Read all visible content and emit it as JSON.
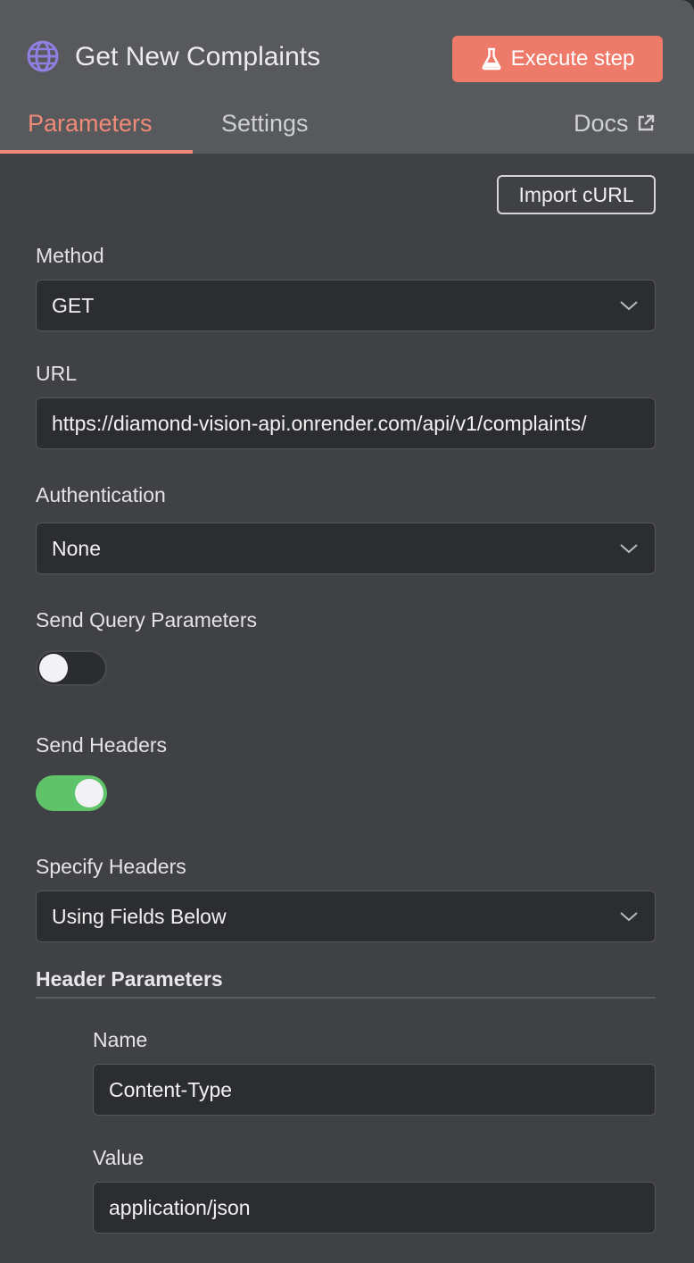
{
  "node": {
    "title": "Get New Complaints",
    "icon": "globe-icon",
    "execute_label": "Execute step"
  },
  "tabs": [
    {
      "label": "Parameters",
      "active": true
    },
    {
      "label": "Settings",
      "active": false
    },
    {
      "label": "Docs",
      "active": false
    }
  ],
  "import_curl_label": "Import cURL",
  "method": {
    "label": "Method",
    "value": "GET"
  },
  "url": {
    "label": "URL",
    "value": "https://diamond-vision-api.onrender.com/api/v1/complaints/"
  },
  "authentication": {
    "label": "Authentication",
    "value": "None"
  },
  "send_query": {
    "label": "Send Query Parameters",
    "enabled": false
  },
  "send_headers": {
    "label": "Send Headers",
    "enabled": true
  },
  "specify_headers": {
    "label": "Specify Headers",
    "value": "Using Fields Below"
  },
  "header_parameters": {
    "title": "Header Parameters",
    "name_label": "Name",
    "name_value": "Content-Type",
    "value_label": "Value",
    "value_value": "application/json"
  },
  "colors": {
    "accent": "#ee7b69",
    "toggle_on": "#5fc36a",
    "header_bg": "#58595c",
    "panel_bg": "#404144"
  }
}
